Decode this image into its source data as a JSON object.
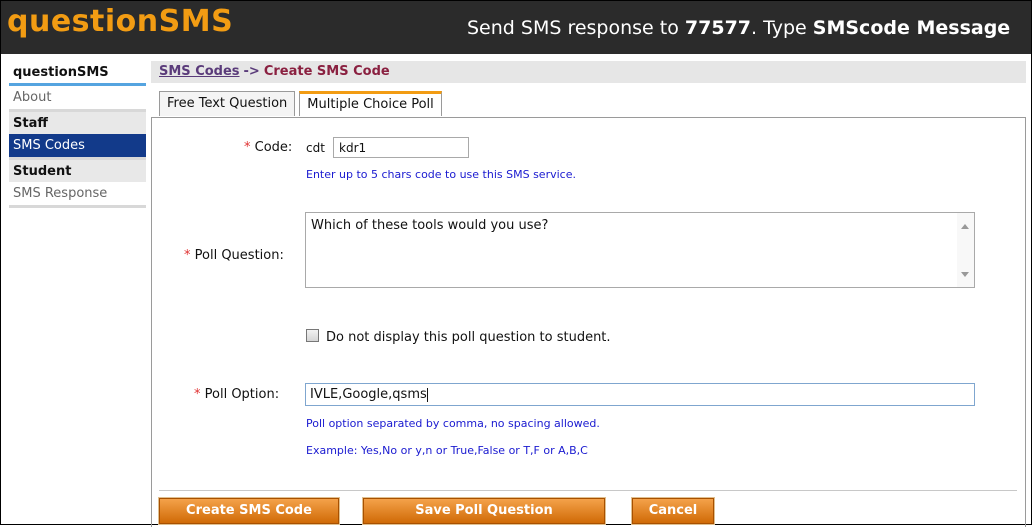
{
  "header": {
    "logo": "questionSMS",
    "tagline_pre": "Send SMS response to ",
    "tagline_number": "77577",
    "tagline_mid": ". Type ",
    "tagline_code": "SMScode Message"
  },
  "sidebar": {
    "sections": [
      {
        "heading": "questionSMS",
        "items": [
          "About"
        ]
      },
      {
        "heading": "Staff",
        "items": [
          "SMS Codes"
        ]
      },
      {
        "heading": "Student",
        "items": [
          "SMS Response"
        ]
      }
    ],
    "active_item": "SMS Codes"
  },
  "breadcrumb": {
    "link": "SMS Codes",
    "separator": "->",
    "current": "Create SMS Code"
  },
  "tabs": [
    {
      "label": "Free Text Question",
      "active": false
    },
    {
      "label": "Multiple Choice Poll",
      "active": true
    }
  ],
  "form": {
    "required_mark": "*",
    "code_label": "Code:",
    "code_prefix": "cdt",
    "code_value": "kdr1",
    "code_hint": "Enter up to 5 chars code to use this SMS service.",
    "question_label": "Poll Question:",
    "question_value": "Which of these tools would you use?",
    "hide_checkbox_label": "Do not display this poll question to student.",
    "hide_checked": false,
    "option_label": "Poll Option:",
    "option_value": "IVLE,Google,qsms",
    "option_hint1": "Poll option separated by comma, no spacing allowed.",
    "option_hint2": "Example: Yes,No or y,n or True,False or T,F or A,B,C"
  },
  "buttons": {
    "create": "Create SMS Code",
    "save": "Save Poll Question",
    "cancel": "Cancel"
  },
  "colors": {
    "accent": "#f29c13",
    "header_bg": "#2b2b2b",
    "active_nav": "#123a8a",
    "hint_text": "#1a1ad0"
  }
}
